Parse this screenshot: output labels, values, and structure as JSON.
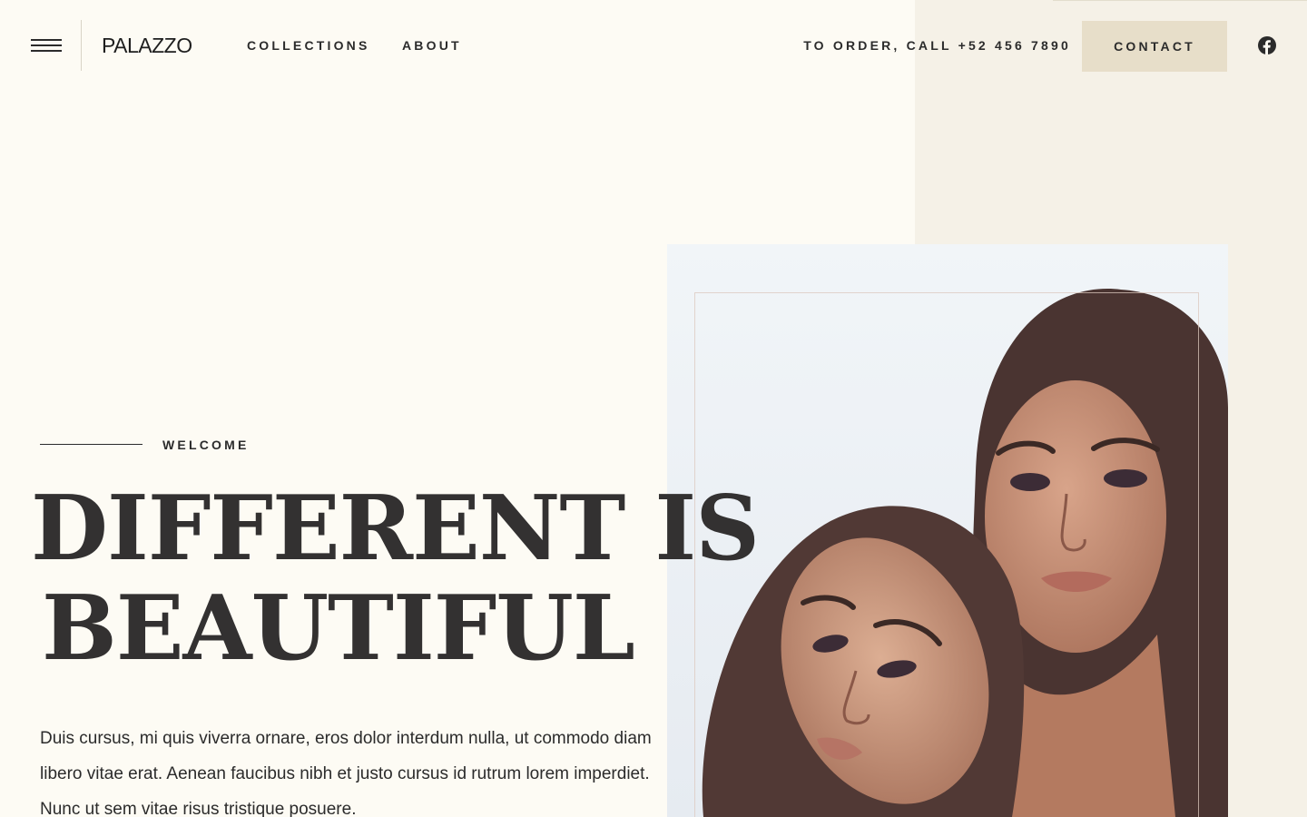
{
  "header": {
    "brand": "PALAZZO",
    "nav": [
      {
        "label": "COLLECTIONS"
      },
      {
        "label": "ABOUT"
      }
    ],
    "order_text": "TO ORDER, CALL +52 456 7890",
    "contact_label": "CONTACT"
  },
  "hero": {
    "eyebrow": "WELCOME",
    "headline_line1": "DIFFERENT IS",
    "headline_line2": "BEAUTIFUL",
    "body": "Duis cursus, mi quis viverra ornare, eros dolor interdum nulla, ut commodo diam libero vitae erat. Aenean faucibus nibh et justo cursus id rutrum lorem imperdiet. Nunc ut sem vitae risus tristique posuere."
  },
  "icons": {
    "menu": "hamburger-menu-icon",
    "social": "facebook-icon"
  },
  "colors": {
    "background": "#fdfbf4",
    "panel": "#f5f1e7",
    "contact_button": "#e7dec9",
    "text": "#2b2b2b"
  }
}
